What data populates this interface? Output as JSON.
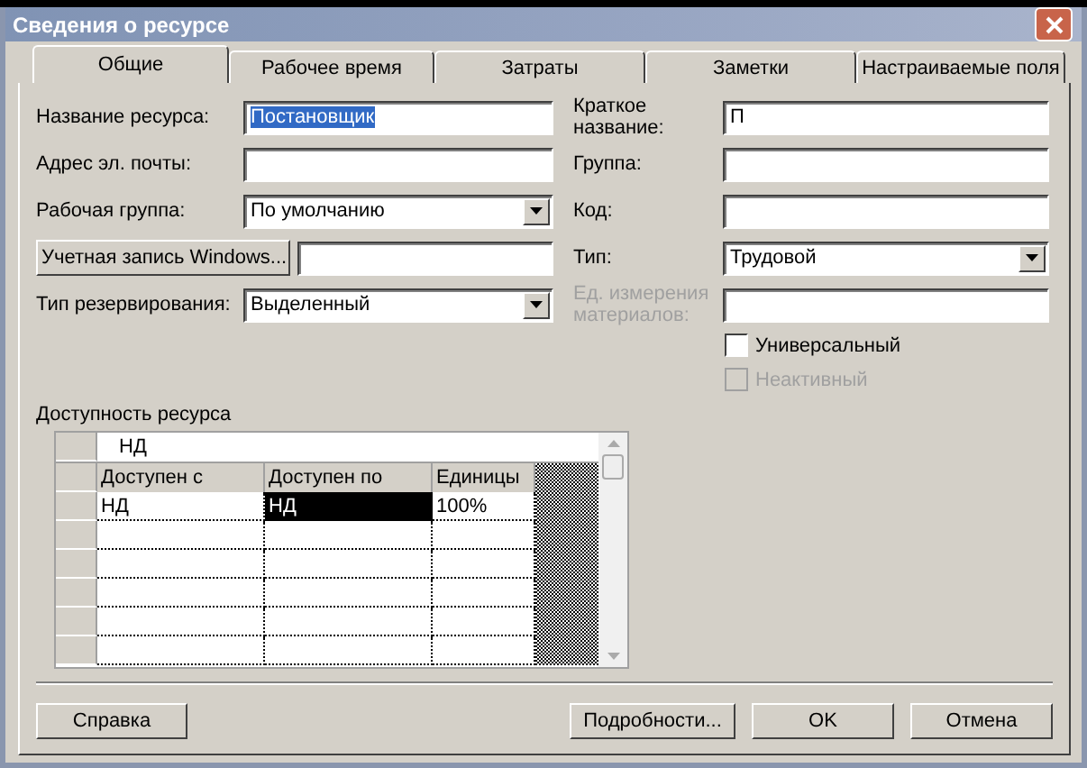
{
  "window": {
    "title": "Сведения о ресурсе"
  },
  "tabs": [
    {
      "label": "Общие",
      "selected": true
    },
    {
      "label": "Рабочее время",
      "selected": false
    },
    {
      "label": "Затраты",
      "selected": false
    },
    {
      "label": "Заметки",
      "selected": false
    },
    {
      "label": "Настраиваемые поля",
      "selected": false
    }
  ],
  "left_fields": [
    {
      "kind": "text",
      "label": "Название ресурса:",
      "value": "Постановщик",
      "highlighted": true
    },
    {
      "kind": "text",
      "label": "Адрес эл. почты:"
    },
    {
      "kind": "combo",
      "label": "Рабочая группа:",
      "value": "По умолчанию"
    },
    {
      "kind": "button",
      "label": "Учетная запись Windows..."
    },
    {
      "kind": "combo",
      "label": "Тип резервирования:",
      "value": "Выделенный"
    }
  ],
  "right_fields": [
    {
      "kind": "text",
      "label": "Краткое название:",
      "value": "П",
      "disabled": false
    },
    {
      "kind": "text",
      "label": "Группа:",
      "disabled": false
    },
    {
      "kind": "text",
      "label": "Код:",
      "disabled": false
    },
    {
      "kind": "combo",
      "label": "Тип:",
      "value": "Трудовой",
      "disabled": false
    },
    {
      "kind": "text",
      "label": "Ед. измерения материалов:",
      "disabled": true
    }
  ],
  "checkboxes": [
    {
      "label": "Универсальный",
      "checked": false,
      "disabled": false
    },
    {
      "label": "Неактивный",
      "checked": false,
      "disabled": true
    }
  ],
  "availability": {
    "label": "Доступность ресурса",
    "edit_value": "НД",
    "columns": [
      "Доступен с",
      "Доступен по",
      "Единицы"
    ],
    "rows": [
      {
        "cells": [
          {
            "text": "НД",
            "selected": false
          },
          {
            "text": "НД",
            "selected": true
          },
          {
            "text": "100%",
            "selected": false
          }
        ]
      }
    ]
  },
  "help_button": "Справка",
  "buttons": [
    "Подробности...",
    "OK",
    "Отмена"
  ]
}
